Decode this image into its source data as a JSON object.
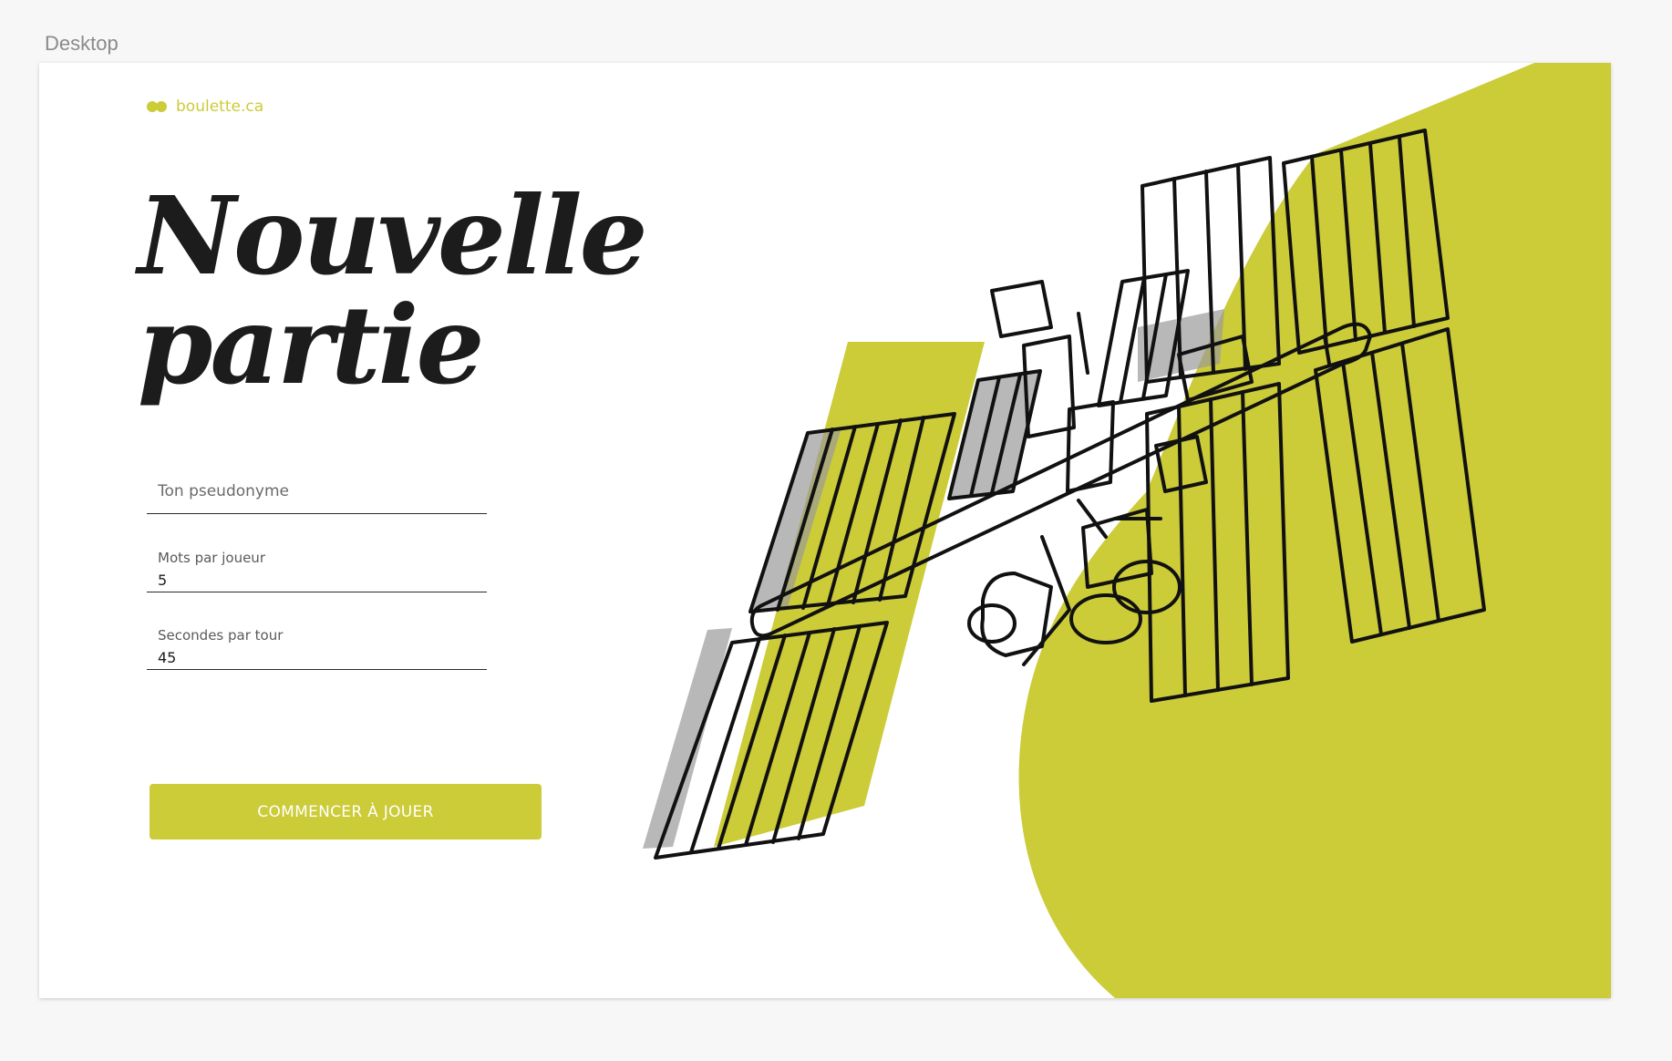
{
  "canvas": {
    "frame_label": "Desktop"
  },
  "colors": {
    "accent": "#cccb38",
    "ink": "#1c1c1c",
    "panel_gray": "#9a9a9a"
  },
  "brand": {
    "name": "boulette.ca",
    "icon": "two-dots-logo-icon"
  },
  "page": {
    "title_line1": "Nouvelle",
    "title_line2": "partie"
  },
  "form": {
    "nickname": {
      "placeholder": "Ton pseudonyme",
      "value": ""
    },
    "words_per_player": {
      "label": "Mots par joueur",
      "value": "5"
    },
    "seconds_per_turn": {
      "label": "Secondes par tour",
      "value": "45"
    },
    "submit_label": "COMMENCER À JOUER"
  },
  "illustration": {
    "subject": "space-station-illustration"
  }
}
